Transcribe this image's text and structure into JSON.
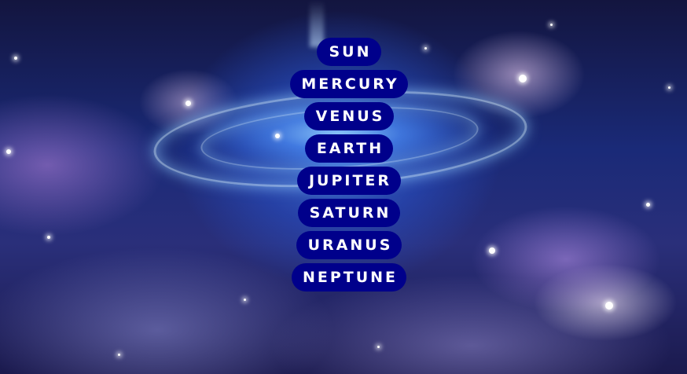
{
  "background": {
    "description_icon": "galaxy-background-image"
  },
  "colors": {
    "button_bg": "#00008b",
    "button_text": "#ffffff"
  },
  "planets": [
    {
      "label": "SUN"
    },
    {
      "label": "MERCURY"
    },
    {
      "label": "VENUS"
    },
    {
      "label": "EARTH"
    },
    {
      "label": "JUPITER"
    },
    {
      "label": "SATURN"
    },
    {
      "label": "URANUS"
    },
    {
      "label": "NEPTUNE"
    }
  ]
}
